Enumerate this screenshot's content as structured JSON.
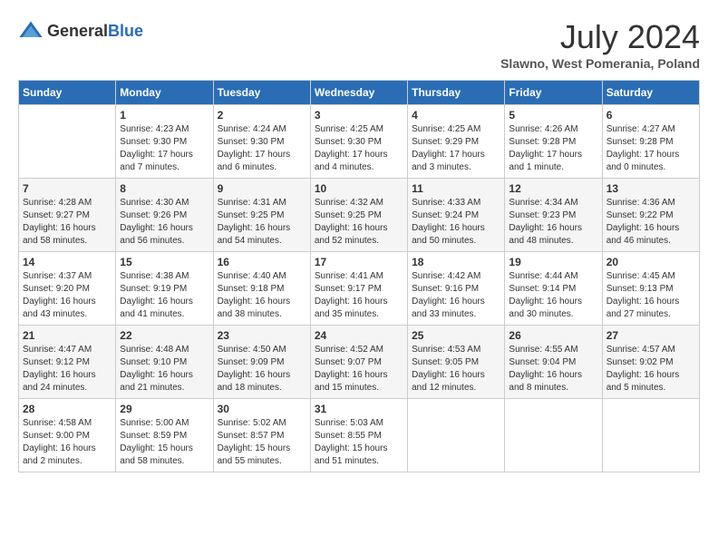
{
  "header": {
    "logo_general": "General",
    "logo_blue": "Blue",
    "month_year": "July 2024",
    "location": "Slawno, West Pomerania, Poland"
  },
  "calendar": {
    "days_of_week": [
      "Sunday",
      "Monday",
      "Tuesday",
      "Wednesday",
      "Thursday",
      "Friday",
      "Saturday"
    ],
    "weeks": [
      [
        {
          "day": "",
          "content": ""
        },
        {
          "day": "1",
          "content": "Sunrise: 4:23 AM\nSunset: 9:30 PM\nDaylight: 17 hours\nand 7 minutes."
        },
        {
          "day": "2",
          "content": "Sunrise: 4:24 AM\nSunset: 9:30 PM\nDaylight: 17 hours\nand 6 minutes."
        },
        {
          "day": "3",
          "content": "Sunrise: 4:25 AM\nSunset: 9:30 PM\nDaylight: 17 hours\nand 4 minutes."
        },
        {
          "day": "4",
          "content": "Sunrise: 4:25 AM\nSunset: 9:29 PM\nDaylight: 17 hours\nand 3 minutes."
        },
        {
          "day": "5",
          "content": "Sunrise: 4:26 AM\nSunset: 9:28 PM\nDaylight: 17 hours\nand 1 minute."
        },
        {
          "day": "6",
          "content": "Sunrise: 4:27 AM\nSunset: 9:28 PM\nDaylight: 17 hours\nand 0 minutes."
        }
      ],
      [
        {
          "day": "7",
          "content": "Sunrise: 4:28 AM\nSunset: 9:27 PM\nDaylight: 16 hours\nand 58 minutes."
        },
        {
          "day": "8",
          "content": "Sunrise: 4:30 AM\nSunset: 9:26 PM\nDaylight: 16 hours\nand 56 minutes."
        },
        {
          "day": "9",
          "content": "Sunrise: 4:31 AM\nSunset: 9:25 PM\nDaylight: 16 hours\nand 54 minutes."
        },
        {
          "day": "10",
          "content": "Sunrise: 4:32 AM\nSunset: 9:25 PM\nDaylight: 16 hours\nand 52 minutes."
        },
        {
          "day": "11",
          "content": "Sunrise: 4:33 AM\nSunset: 9:24 PM\nDaylight: 16 hours\nand 50 minutes."
        },
        {
          "day": "12",
          "content": "Sunrise: 4:34 AM\nSunset: 9:23 PM\nDaylight: 16 hours\nand 48 minutes."
        },
        {
          "day": "13",
          "content": "Sunrise: 4:36 AM\nSunset: 9:22 PM\nDaylight: 16 hours\nand 46 minutes."
        }
      ],
      [
        {
          "day": "14",
          "content": "Sunrise: 4:37 AM\nSunset: 9:20 PM\nDaylight: 16 hours\nand 43 minutes."
        },
        {
          "day": "15",
          "content": "Sunrise: 4:38 AM\nSunset: 9:19 PM\nDaylight: 16 hours\nand 41 minutes."
        },
        {
          "day": "16",
          "content": "Sunrise: 4:40 AM\nSunset: 9:18 PM\nDaylight: 16 hours\nand 38 minutes."
        },
        {
          "day": "17",
          "content": "Sunrise: 4:41 AM\nSunset: 9:17 PM\nDaylight: 16 hours\nand 35 minutes."
        },
        {
          "day": "18",
          "content": "Sunrise: 4:42 AM\nSunset: 9:16 PM\nDaylight: 16 hours\nand 33 minutes."
        },
        {
          "day": "19",
          "content": "Sunrise: 4:44 AM\nSunset: 9:14 PM\nDaylight: 16 hours\nand 30 minutes."
        },
        {
          "day": "20",
          "content": "Sunrise: 4:45 AM\nSunset: 9:13 PM\nDaylight: 16 hours\nand 27 minutes."
        }
      ],
      [
        {
          "day": "21",
          "content": "Sunrise: 4:47 AM\nSunset: 9:12 PM\nDaylight: 16 hours\nand 24 minutes."
        },
        {
          "day": "22",
          "content": "Sunrise: 4:48 AM\nSunset: 9:10 PM\nDaylight: 16 hours\nand 21 minutes."
        },
        {
          "day": "23",
          "content": "Sunrise: 4:50 AM\nSunset: 9:09 PM\nDaylight: 16 hours\nand 18 minutes."
        },
        {
          "day": "24",
          "content": "Sunrise: 4:52 AM\nSunset: 9:07 PM\nDaylight: 16 hours\nand 15 minutes."
        },
        {
          "day": "25",
          "content": "Sunrise: 4:53 AM\nSunset: 9:05 PM\nDaylight: 16 hours\nand 12 minutes."
        },
        {
          "day": "26",
          "content": "Sunrise: 4:55 AM\nSunset: 9:04 PM\nDaylight: 16 hours\nand 8 minutes."
        },
        {
          "day": "27",
          "content": "Sunrise: 4:57 AM\nSunset: 9:02 PM\nDaylight: 16 hours\nand 5 minutes."
        }
      ],
      [
        {
          "day": "28",
          "content": "Sunrise: 4:58 AM\nSunset: 9:00 PM\nDaylight: 16 hours\nand 2 minutes."
        },
        {
          "day": "29",
          "content": "Sunrise: 5:00 AM\nSunset: 8:59 PM\nDaylight: 15 hours\nand 58 minutes."
        },
        {
          "day": "30",
          "content": "Sunrise: 5:02 AM\nSunset: 8:57 PM\nDaylight: 15 hours\nand 55 minutes."
        },
        {
          "day": "31",
          "content": "Sunrise: 5:03 AM\nSunset: 8:55 PM\nDaylight: 15 hours\nand 51 minutes."
        },
        {
          "day": "",
          "content": ""
        },
        {
          "day": "",
          "content": ""
        },
        {
          "day": "",
          "content": ""
        }
      ]
    ]
  }
}
